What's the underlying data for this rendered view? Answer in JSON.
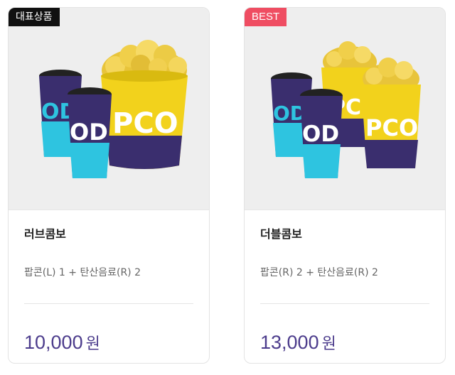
{
  "products": [
    {
      "badge": "대표상품",
      "name": "러브콤보",
      "description": "팝콘(L) 1 + 탄산음료(R) 2",
      "price": "10,000",
      "currency": "원",
      "image_alt": "popcorn-large-and-two-drinks"
    },
    {
      "badge": "BEST",
      "name": "더블콤보",
      "description": "팝콘(R) 2 + 탄산음료(R) 2",
      "price": "13,000",
      "currency": "원",
      "image_alt": "two-popcorns-and-two-drinks"
    }
  ],
  "colors": {
    "badge_primary": "#111111",
    "badge_best": "#ef4d62",
    "price": "#4c3c8c",
    "cup_navy": "#3a2e6e",
    "cup_cyan": "#2ec4e0",
    "popcorn_yellow": "#f2d21c"
  }
}
